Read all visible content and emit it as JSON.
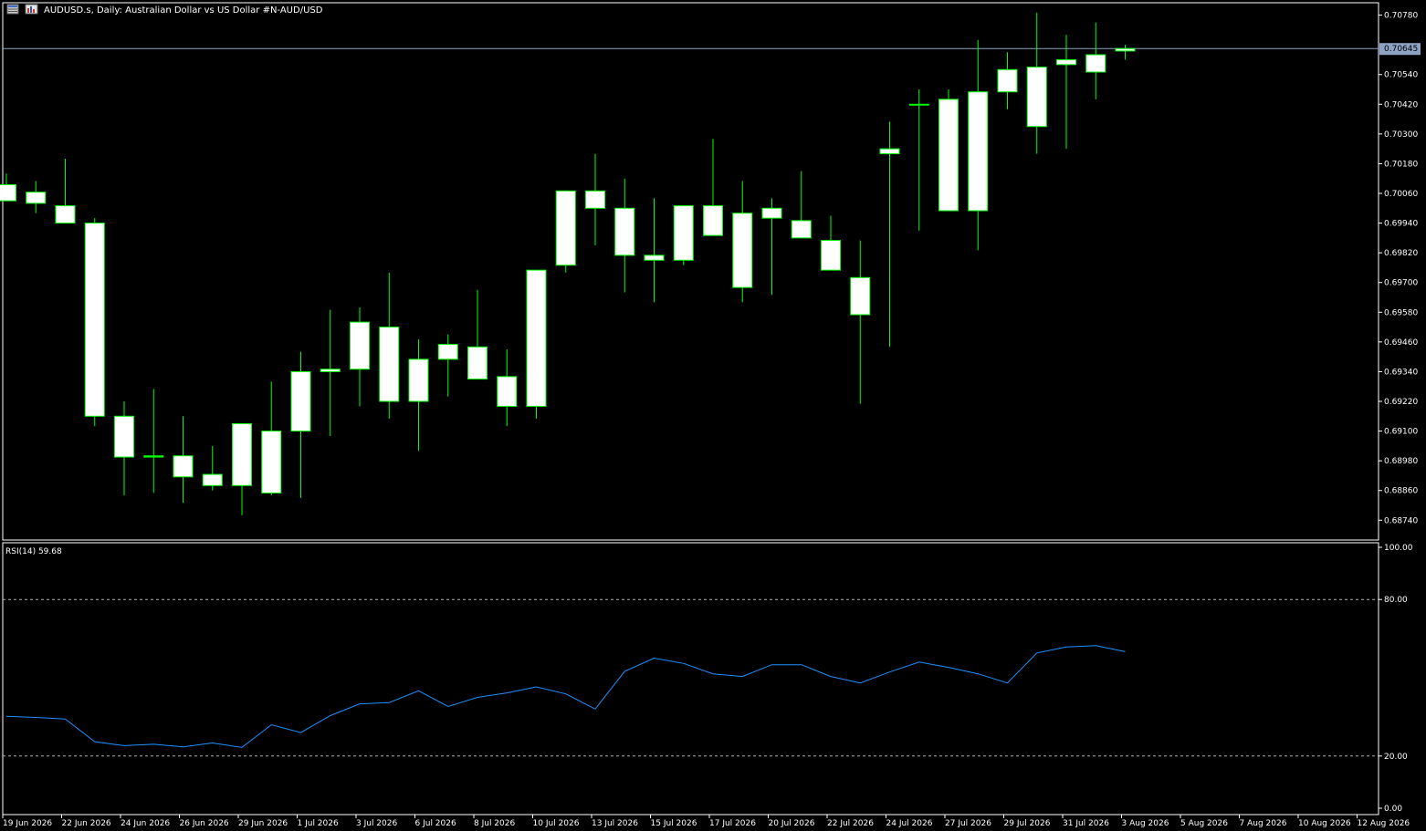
{
  "header": {
    "title": "AUDUSD.s, Daily:  Australian Dollar vs US Dollar #N-AUD/USD"
  },
  "icons": [
    "window-grid-icon",
    "chart-type-icon"
  ],
  "price_axis": {
    "ticks": [
      "0.70780",
      "0.70540",
      "0.70420",
      "0.70300",
      "0.70180",
      "0.70060",
      "0.69940",
      "0.69820",
      "0.69700",
      "0.69580",
      "0.69460",
      "0.69340",
      "0.69220",
      "0.69100",
      "0.68980",
      "0.68860",
      "0.68740"
    ],
    "current_price_label": "0.70645"
  },
  "rsi_panel": {
    "label": "RSI(14) 59.68",
    "ticks": [
      "100.00",
      "80.00",
      "20.00",
      "0.00"
    ]
  },
  "date_labels": [
    "19 Jun 2026",
    "22 Jun 2026",
    "24 Jun 2026",
    "26 Jun 2026",
    "29 Jun 2026",
    "1 Jul 2026",
    "3 Jul 2026",
    "6 Jul 2026",
    "8 Jul 2026",
    "10 Jul 2026",
    "13 Jul 2026",
    "15 Jul 2026",
    "17 Jul 2026",
    "20 Jul 2026",
    "22 Jul 2026",
    "24 Jul 2026",
    "27 Jul 2026",
    "29 Jul 2026",
    "31 Jul 2026",
    "3 Aug 2026",
    "5 Aug 2026",
    "7 Aug 2026",
    "10 Aug 2026",
    "12 Aug 2026"
  ],
  "colors": {
    "background": "#000000",
    "candle_outline": "#00ff00",
    "candle_body": "#ffffff",
    "rsi_line": "#1e90ff",
    "level_line": "#b0b0b0",
    "price_line": "#8ea2c4",
    "axis_text": "#ffffff"
  },
  "chart_data": [
    {
      "type": "candlestick",
      "symbol": "AUDUSD.s",
      "timeframe": "Daily",
      "ylim": [
        0.6866,
        0.7083
      ],
      "current_price": 0.70645,
      "x": [
        "19 Jun 2026",
        "22 Jun 2026",
        "23 Jun 2026",
        "24 Jun 2026",
        "25 Jun 2026",
        "26 Jun 2026",
        "29 Jun 2026",
        "30 Jun 2026",
        "1 Jul 2026",
        "2 Jul 2026",
        "3 Jul 2026",
        "6 Jul 2026",
        "7 Jul 2026",
        "8 Jul 2026",
        "9 Jul 2026",
        "10 Jul 2026",
        "13 Jul 2026",
        "14 Jul 2026",
        "15 Jul 2026",
        "16 Jul 2026",
        "17 Jul 2026",
        "20 Jul 2026",
        "21 Jul 2026",
        "22 Jul 2026",
        "23 Jul 2026",
        "24 Jul 2026",
        "27 Jul 2026",
        "28 Jul 2026",
        "29 Jul 2026",
        "30 Jul 2026",
        "31 Jul 2026",
        "3 Aug 2026",
        "4 Aug 2026",
        "5 Aug 2026",
        "6 Aug 2026",
        "7 Aug 2026",
        "10 Aug 2026",
        "11 Aug 2026",
        "12 Aug 2026"
      ],
      "open": [
        0.70095,
        0.70065,
        0.7001,
        0.6994,
        0.6916,
        0.68995,
        0.69,
        0.68925,
        0.6888,
        0.6885,
        0.691,
        0.6934,
        0.6935,
        0.6952,
        0.6922,
        0.6939,
        0.6944,
        0.6932,
        0.692,
        0.6977,
        0.7007,
        0.7,
        0.6981,
        0.6979,
        0.7001,
        0.6998,
        0.7,
        0.6995,
        0.6987,
        0.6957,
        0.7024,
        0.7042,
        0.6999,
        0.6999,
        0.7047,
        0.7033,
        0.7058,
        0.7055,
        0.70635
      ],
      "high": [
        0.7014,
        0.7011,
        0.702,
        0.6996,
        0.6922,
        0.6927,
        0.6916,
        0.6904,
        0.6902,
        0.693,
        0.6942,
        0.6959,
        0.696,
        0.6974,
        0.6947,
        0.6949,
        0.6967,
        0.6943,
        0.6953,
        0.6993,
        0.7022,
        0.7012,
        0.7004,
        0.6992,
        0.7028,
        0.7011,
        0.7004,
        0.7015,
        0.6997,
        0.6987,
        0.7035,
        0.7048,
        0.7048,
        0.7068,
        0.7063,
        0.7079,
        0.707,
        0.7075,
        0.7066
      ],
      "low": [
        0.7003,
        0.6998,
        0.6994,
        0.6912,
        0.6884,
        0.6885,
        0.6881,
        0.6886,
        0.6876,
        0.6884,
        0.6883,
        0.6908,
        0.692,
        0.6915,
        0.6902,
        0.6924,
        0.6931,
        0.6912,
        0.6915,
        0.6974,
        0.6985,
        0.6966,
        0.6962,
        0.6977,
        0.6989,
        0.6962,
        0.6965,
        0.6988,
        0.6978,
        0.6921,
        0.6944,
        0.6991,
        0.7036,
        0.6983,
        0.704,
        0.7022,
        0.7024,
        0.7044,
        0.706
      ],
      "close": [
        0.7003,
        0.7002,
        0.6994,
        0.6916,
        0.68995,
        0.69,
        0.68915,
        0.6888,
        0.6913,
        0.691,
        0.6934,
        0.6935,
        0.6954,
        0.6922,
        0.6939,
        0.6945,
        0.6931,
        0.692,
        0.6975,
        0.7007,
        0.7,
        0.6981,
        0.6979,
        0.7001,
        0.6989,
        0.6968,
        0.6996,
        0.6988,
        0.6975,
        0.6972,
        0.7022,
        0.7042,
        0.7044,
        0.7047,
        0.7056,
        0.7057,
        0.706,
        0.7062,
        0.70645
      ]
    },
    {
      "type": "line",
      "name": "RSI(14)",
      "ylim": [
        0,
        100
      ],
      "levels": [
        20,
        80
      ],
      "x": [
        "19 Jun 2026",
        "22 Jun 2026",
        "23 Jun 2026",
        "24 Jun 2026",
        "25 Jun 2026",
        "26 Jun 2026",
        "29 Jun 2026",
        "30 Jun 2026",
        "1 Jul 2026",
        "2 Jul 2026",
        "3 Jul 2026",
        "6 Jul 2026",
        "7 Jul 2026",
        "8 Jul 2026",
        "9 Jul 2026",
        "10 Jul 2026",
        "13 Jul 2026",
        "14 Jul 2026",
        "15 Jul 2026",
        "16 Jul 2026",
        "17 Jul 2026",
        "20 Jul 2026",
        "21 Jul 2026",
        "22 Jul 2026",
        "23 Jul 2026",
        "24 Jul 2026",
        "27 Jul 2026",
        "28 Jul 2026",
        "29 Jul 2026",
        "30 Jul 2026",
        "31 Jul 2026",
        "3 Aug 2026",
        "4 Aug 2026",
        "5 Aug 2026",
        "6 Aug 2026",
        "7 Aug 2026",
        "10 Aug 2026",
        "11 Aug 2026",
        "12 Aug 2026"
      ],
      "values": [
        35.2,
        34.8,
        34.2,
        25.5,
        24.0,
        24.5,
        23.5,
        25.0,
        23.3,
        32.0,
        29.0,
        35.5,
        40.0,
        40.5,
        45.0,
        39.0,
        42.5,
        44.2,
        46.5,
        43.8,
        38.0,
        52.5,
        57.5,
        55.5,
        51.5,
        50.5,
        55.0,
        55.0,
        50.5,
        48.0,
        52.2,
        56.0,
        54.0,
        51.5,
        48.0,
        59.5,
        61.8,
        62.3,
        60.0
      ]
    }
  ]
}
